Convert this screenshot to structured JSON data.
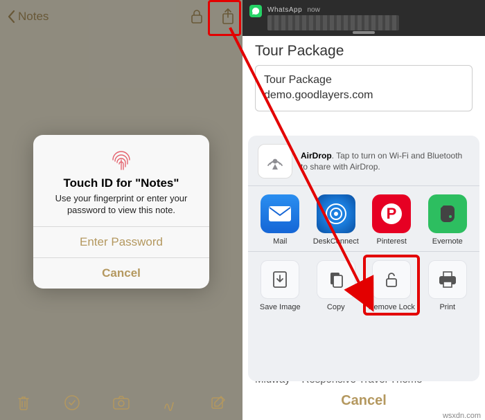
{
  "watermark": "wsxdn.com",
  "left": {
    "back_label": "Notes",
    "touchid": {
      "title": "Touch ID for \"Notes\"",
      "message": "Use your fingerprint or enter your password to view this note.",
      "enter_password": "Enter Password",
      "cancel": "Cancel"
    }
  },
  "right": {
    "banner": {
      "app": "WhatsApp",
      "time": "now"
    },
    "page_title": "Tour Package",
    "card": {
      "title": "Tour Package",
      "url": "demo.goodlayers.com"
    },
    "airdrop": {
      "label": "AirDrop",
      "text": ". Tap to turn on Wi-Fi and Bluetooth to share with AirDrop."
    },
    "apps": {
      "mail": "Mail",
      "deskconnect": "DeskConnect",
      "pinterest": "Pinterest",
      "evernote": "Evernote"
    },
    "actions": {
      "save_image": "Save Image",
      "copy": "Copy",
      "remove_lock": "Remove Lock",
      "print": "Print"
    },
    "peek": "Midway – Responsive Travel Theme",
    "cancel": "Cancel"
  }
}
